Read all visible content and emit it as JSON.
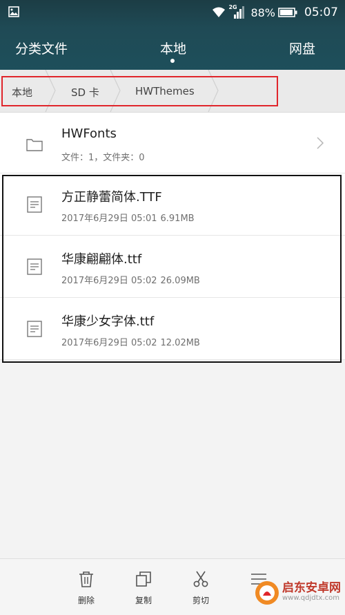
{
  "status_bar": {
    "network": "2G",
    "battery_percent": "88%",
    "time": "05:07"
  },
  "tabs": [
    {
      "label": "分类文件"
    },
    {
      "label": "本地",
      "selected": true
    },
    {
      "label": "网盘"
    }
  ],
  "breadcrumb": [
    "本地",
    "SD 卡",
    "HWThemes"
  ],
  "folder": {
    "name": "HWFonts",
    "file_count": "文件：1，文件夹：0"
  },
  "files": [
    {
      "name": "方正静蕾简体.TTF",
      "date": "2017年6月29日 05:01",
      "size": "6.91MB"
    },
    {
      "name": "华康翩翩体.ttf",
      "date": "2017年6月29日 05:02",
      "size": "26.09MB"
    },
    {
      "name": "华康少女字体.ttf",
      "date": "2017年6月29日 05:02",
      "size": "12.02MB"
    }
  ],
  "toolbar": {
    "delete_label": "删除",
    "copy_label": "复制",
    "cut_label": "剪切"
  },
  "watermark": {
    "title": "启东安卓网",
    "url": "www.qdjdtx.com"
  },
  "colors": {
    "header_bg": "#1f4a55",
    "highlight_red": "#e0252b",
    "highlight_black": "#111111"
  },
  "icons": [
    "gallery-icon",
    "wifi-icon",
    "signal-icon",
    "battery-icon",
    "folder-icon",
    "file-icon",
    "chevron-right-icon",
    "trash-icon",
    "copy-icon",
    "scissors-icon",
    "menu-icon"
  ]
}
